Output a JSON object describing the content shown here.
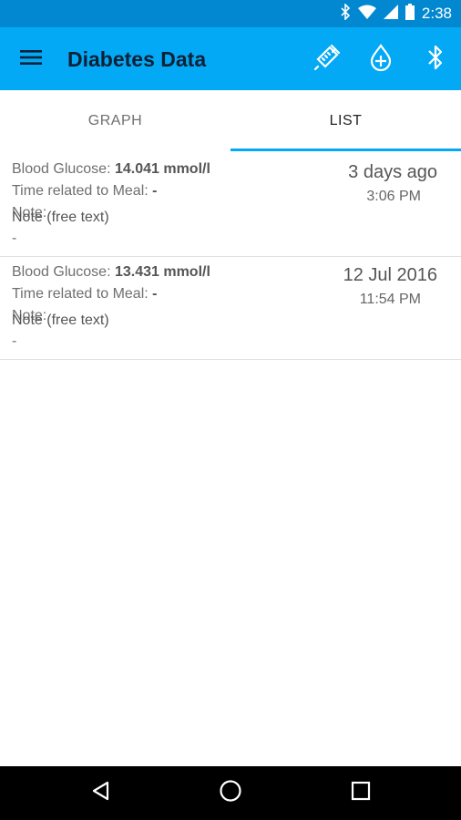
{
  "status_bar": {
    "time": "2:38",
    "icons": [
      "bluetooth-icon",
      "wifi-icon",
      "cellular-signal-icon",
      "battery-icon"
    ]
  },
  "app_bar": {
    "title": "Diabetes Data",
    "icons": {
      "menu": "hamburger-menu-icon",
      "syringe": "syringe-icon",
      "add_drop": "add-drop-icon",
      "bluetooth": "bluetooth-icon"
    }
  },
  "tabs": [
    {
      "label": "GRAPH",
      "selected": false
    },
    {
      "label": "LIST",
      "selected": true
    }
  ],
  "entries": [
    {
      "glucose_label": "Blood Glucose: ",
      "glucose_value": "14.041 mmol/l",
      "meal_label": "Time related to Meal: ",
      "meal_value": "-",
      "note_label": "Note:",
      "note_placeholder": "Note (free text)",
      "note_value": "-",
      "date": "3 days ago",
      "time": "3:06 PM"
    },
    {
      "glucose_label": "Blood Glucose: ",
      "glucose_value": "13.431 mmol/l",
      "meal_label": "Time related to Meal: ",
      "meal_value": "-",
      "note_label": "Note:",
      "note_placeholder": "Note (free text)",
      "note_value": "-",
      "date": "12 Jul 2016",
      "time": "11:54 PM"
    }
  ],
  "colors": {
    "app_bar": "#03a9f4",
    "status_bar": "#0288d1",
    "tab_indicator": "#03a9f4"
  },
  "nav_bar": [
    "back-icon",
    "home-icon",
    "recents-icon"
  ]
}
